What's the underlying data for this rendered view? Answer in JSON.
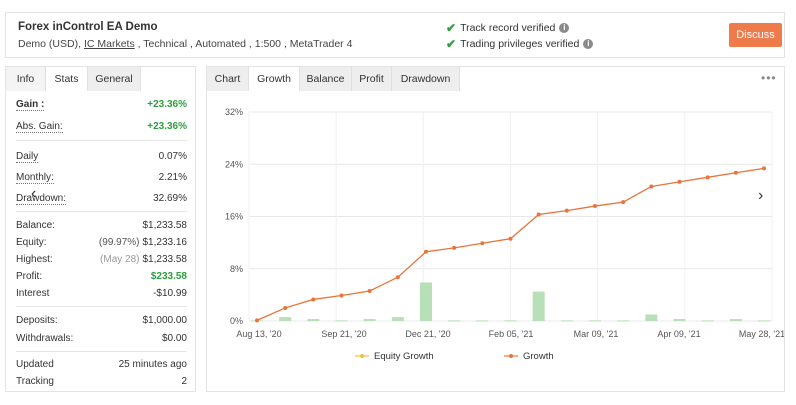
{
  "header": {
    "title": "Forex inControl EA Demo",
    "sub_prefix": "Demo (USD), ",
    "broker": "IC Markets",
    "sub_suffix": " , Technical , Automated , 1:500 , MetaTrader 4",
    "track_record": "Track record verified",
    "trading_privileges": "Trading privileges verified",
    "discuss_label": "Discuss"
  },
  "left_tabs": [
    "Info",
    "Stats",
    "General"
  ],
  "stats": {
    "gain": {
      "label": "Gain :",
      "value": "+23.36%"
    },
    "abs_gain": {
      "label": "Abs. Gain:",
      "value": "+23.36%"
    },
    "daily": {
      "label": "Daily",
      "value": "0.07%"
    },
    "monthly": {
      "label": "Monthly:",
      "value": "2.21%"
    },
    "drawdown": {
      "label": "Drawdown:",
      "value": "32.69%"
    },
    "balance": {
      "label": "Balance:",
      "value": "$1,233.58"
    },
    "equity": {
      "label": "Equity:",
      "muted": "(99.97%)",
      "value": "$1,233.16"
    },
    "highest": {
      "label": "Highest:",
      "muted": "(May 28)",
      "value": "$1,233.58"
    },
    "profit": {
      "label": "Profit:",
      "value": "$233.58"
    },
    "interest": {
      "label": "Interest",
      "value": "-$10.99"
    },
    "deposits": {
      "label": "Deposits:",
      "value": "$1,000.00"
    },
    "withdrawals": {
      "label": "Withdrawals:",
      "value": "$0.00"
    },
    "updated": {
      "label": "Updated",
      "value": "25 minutes ago"
    },
    "tracking": {
      "label": "Tracking",
      "value": "2"
    }
  },
  "right_tabs": [
    "Chart",
    "Growth",
    "Balance",
    "Profit",
    "Drawdown"
  ],
  "more_label": "•••",
  "colors": {
    "accent": "#f07b4a",
    "green": "#2e9e3e",
    "growth_line": "#e8743b",
    "equity_bar": "#b8e0b8"
  },
  "icons": {
    "carousel_left": "chevron-left-icon",
    "carousel_right": "chevron-right-icon",
    "check": "check-icon",
    "info": "info-icon"
  },
  "chart_data": {
    "type": "line",
    "y_ticks": [
      "0%",
      "8%",
      "16%",
      "24%",
      "32%"
    ],
    "x_ticks": [
      "Aug 13, '20",
      "Sep 21, '20",
      "Dec 21, '20",
      "Feb 05, '21",
      "Mar 09, '21",
      "Apr 09, '21",
      "May 28, '21"
    ],
    "ylim": [
      0,
      32
    ],
    "series": [
      {
        "name": "Growth",
        "values": [
          0.1,
          2.0,
          3.3,
          3.9,
          4.6,
          6.7,
          10.6,
          11.2,
          11.9,
          12.6,
          16.3,
          16.9,
          17.6,
          18.2,
          20.6,
          21.3,
          22.0,
          22.7,
          23.36
        ]
      },
      {
        "name": "Equity Growth",
        "values": [
          0.1,
          0.6,
          0.3,
          0.1,
          0.3,
          0.6,
          5.9,
          0.1,
          0.1,
          0.1,
          4.5,
          0.1,
          0.1,
          0.1,
          1.0,
          0.3,
          0.1,
          0.3,
          0.1
        ]
      }
    ],
    "legend": [
      "Equity Growth",
      "Growth"
    ],
    "grid": true
  }
}
